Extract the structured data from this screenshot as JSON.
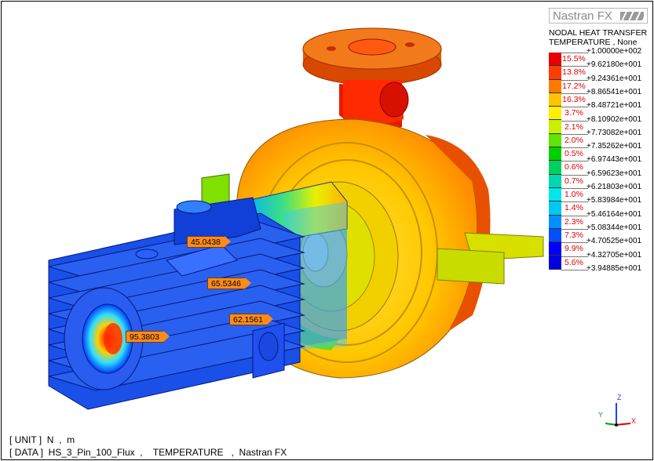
{
  "brand": "Nastran FX",
  "legend": {
    "title_line1": "NODAL HEAT TRANSFER",
    "title_line2": "TEMPERATURE , None",
    "colors": [
      "#e60000",
      "#ff3c00",
      "#ff7a00",
      "#ffc400",
      "#fff000",
      "#c8f000",
      "#60e400",
      "#00d000",
      "#00d060",
      "#00d8b0",
      "#00e8e8",
      "#00c8f0",
      "#0090ff",
      "#0050ff",
      "#0000ff"
    ],
    "percents": [
      "15.5%",
      "13.8%",
      "17.2%",
      "16.3%",
      "3.7%",
      "2.1%",
      "2.0%",
      "0.5%",
      "0.6%",
      "0.7%",
      "1.0%",
      "1.4%",
      "2.3%",
      "7.3%",
      "9.9%",
      "5.6%"
    ],
    "values": [
      "+1.00000e+002",
      "+9.62180e+001",
      "+9.24361e+001",
      "+8.86541e+001",
      "+8.48721e+001",
      "+8.10902e+001",
      "+7.73082e+001",
      "+7.35262e+001",
      "+6.97443e+001",
      "+6.59623e+001",
      "+6.21803e+001",
      "+5.83984e+001",
      "+5.46164e+001",
      "+5.08344e+001",
      "+4.70525e+001",
      "+4.32705e+001",
      "+3.94885e+001"
    ],
    "extra_color": "#0000e0"
  },
  "probes": [
    "45.0438",
    "65.5346",
    "62.1561",
    "95.3803"
  ],
  "info": {
    "unit_line": "[ UNIT ]  N  ,  m",
    "data_line": "[ DATA ]  HS_3_Pin_100_Flux  ,    TEMPERATURE   ,  Nastran FX"
  },
  "axis": {
    "x": "X",
    "y": "Y",
    "z": "Z"
  }
}
